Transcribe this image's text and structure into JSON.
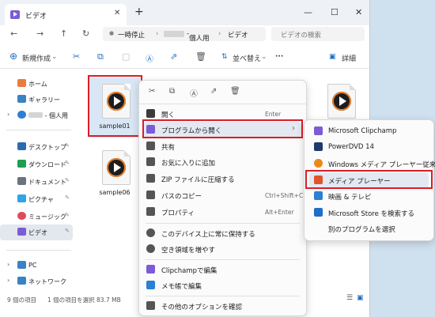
{
  "window": {
    "tab_title": "ビデオ",
    "tab_close": "✕",
    "new_tab": "+",
    "controls": {
      "minimize": "—",
      "maximize": "☐",
      "close": "✕"
    }
  },
  "nav": {
    "back": "←",
    "forward": "→",
    "up": "↑",
    "refresh": "↻",
    "pause_label": "一時停止",
    "breadcrumb_user": "個人用",
    "breadcrumb_folder": "ビデオ",
    "search_placeholder": "ビデオの検索",
    "sep": "›"
  },
  "toolbar": {
    "new_label": "新規作成",
    "sort_label": "並べ替え",
    "more_label": "···",
    "details_label": "詳細"
  },
  "sidebar": {
    "items": [
      {
        "label": "ホーム",
        "color": "#e87d3e"
      },
      {
        "label": "ギャラリー",
        "color": "#3b82c4"
      },
      {
        "label": "個人用",
        "color": "#2d7fd3"
      },
      {
        "label": "デスクトップ",
        "color": "#2b6cb0"
      },
      {
        "label": "ダウンロード",
        "color": "#1f9d55"
      },
      {
        "label": "ドキュメント",
        "color": "#6b7280"
      },
      {
        "label": "ピクチャ",
        "color": "#2fa4e7"
      },
      {
        "label": "ミュージック",
        "color": "#e04b5a"
      },
      {
        "label": "ビデオ",
        "color": "#7b5cd6"
      },
      {
        "label": "PC",
        "color": "#3b82c4"
      },
      {
        "label": "ネットワーク",
        "color": "#3b82c4"
      }
    ]
  },
  "files": [
    {
      "name": "sample01"
    },
    {
      "name": "sample06"
    }
  ],
  "status": {
    "count": "9 個の項目",
    "selected": "1 個の項目を選択 83.7 MB"
  },
  "context_menu": {
    "items": [
      {
        "label": "開く",
        "shortcut": "Enter",
        "color": "#3b3b3b"
      },
      {
        "label": "プログラムから開く",
        "shortcut": "",
        "color": "#7b5cd6"
      },
      {
        "label": "共有",
        "shortcut": "",
        "color": "#555555"
      },
      {
        "label": "お気に入りに追加",
        "shortcut": "",
        "color": "#555555"
      },
      {
        "label": "ZIP ファイルに圧縮する",
        "shortcut": "",
        "color": "#555555"
      },
      {
        "label": "パスのコピー",
        "shortcut": "Ctrl+Shift+C",
        "color": "#555555"
      },
      {
        "label": "プロパティ",
        "shortcut": "Alt+Enter",
        "color": "#555555"
      },
      {
        "label": "このデバイス上に常に保持する",
        "shortcut": "",
        "color": "#555555"
      },
      {
        "label": "空き領域を増やす",
        "shortcut": "",
        "color": "#555555"
      },
      {
        "label": "Clipchampで編集",
        "shortcut": "",
        "color": "#7b5cd6"
      },
      {
        "label": "メモ帳で編集",
        "shortcut": "",
        "color": "#2d7fd3"
      },
      {
        "label": "その他のオプションを確認",
        "shortcut": "",
        "color": "#555555"
      }
    ],
    "submenu_arrow": "›"
  },
  "submenu": {
    "items": [
      {
        "label": "Microsoft Clipchamp",
        "color": "#7b5cd6"
      },
      {
        "label": "PowerDVD 14",
        "color": "#1d3b6b"
      },
      {
        "label": "Windows メディア プレーヤー従来版",
        "color": "#e88a1a"
      },
      {
        "label": "メディア プレーヤー",
        "color": "#e0542b"
      },
      {
        "label": "映画 & テレビ",
        "color": "#2d7fd3"
      },
      {
        "label": "Microsoft Store を検索する",
        "color": "#1f6fc6"
      },
      {
        "label": "別のプログラムを選択",
        "color": ""
      }
    ]
  },
  "colors": {
    "highlight_border": "#d81e28",
    "accent": "#7b5cd6",
    "play_ring": "#e9812a"
  }
}
